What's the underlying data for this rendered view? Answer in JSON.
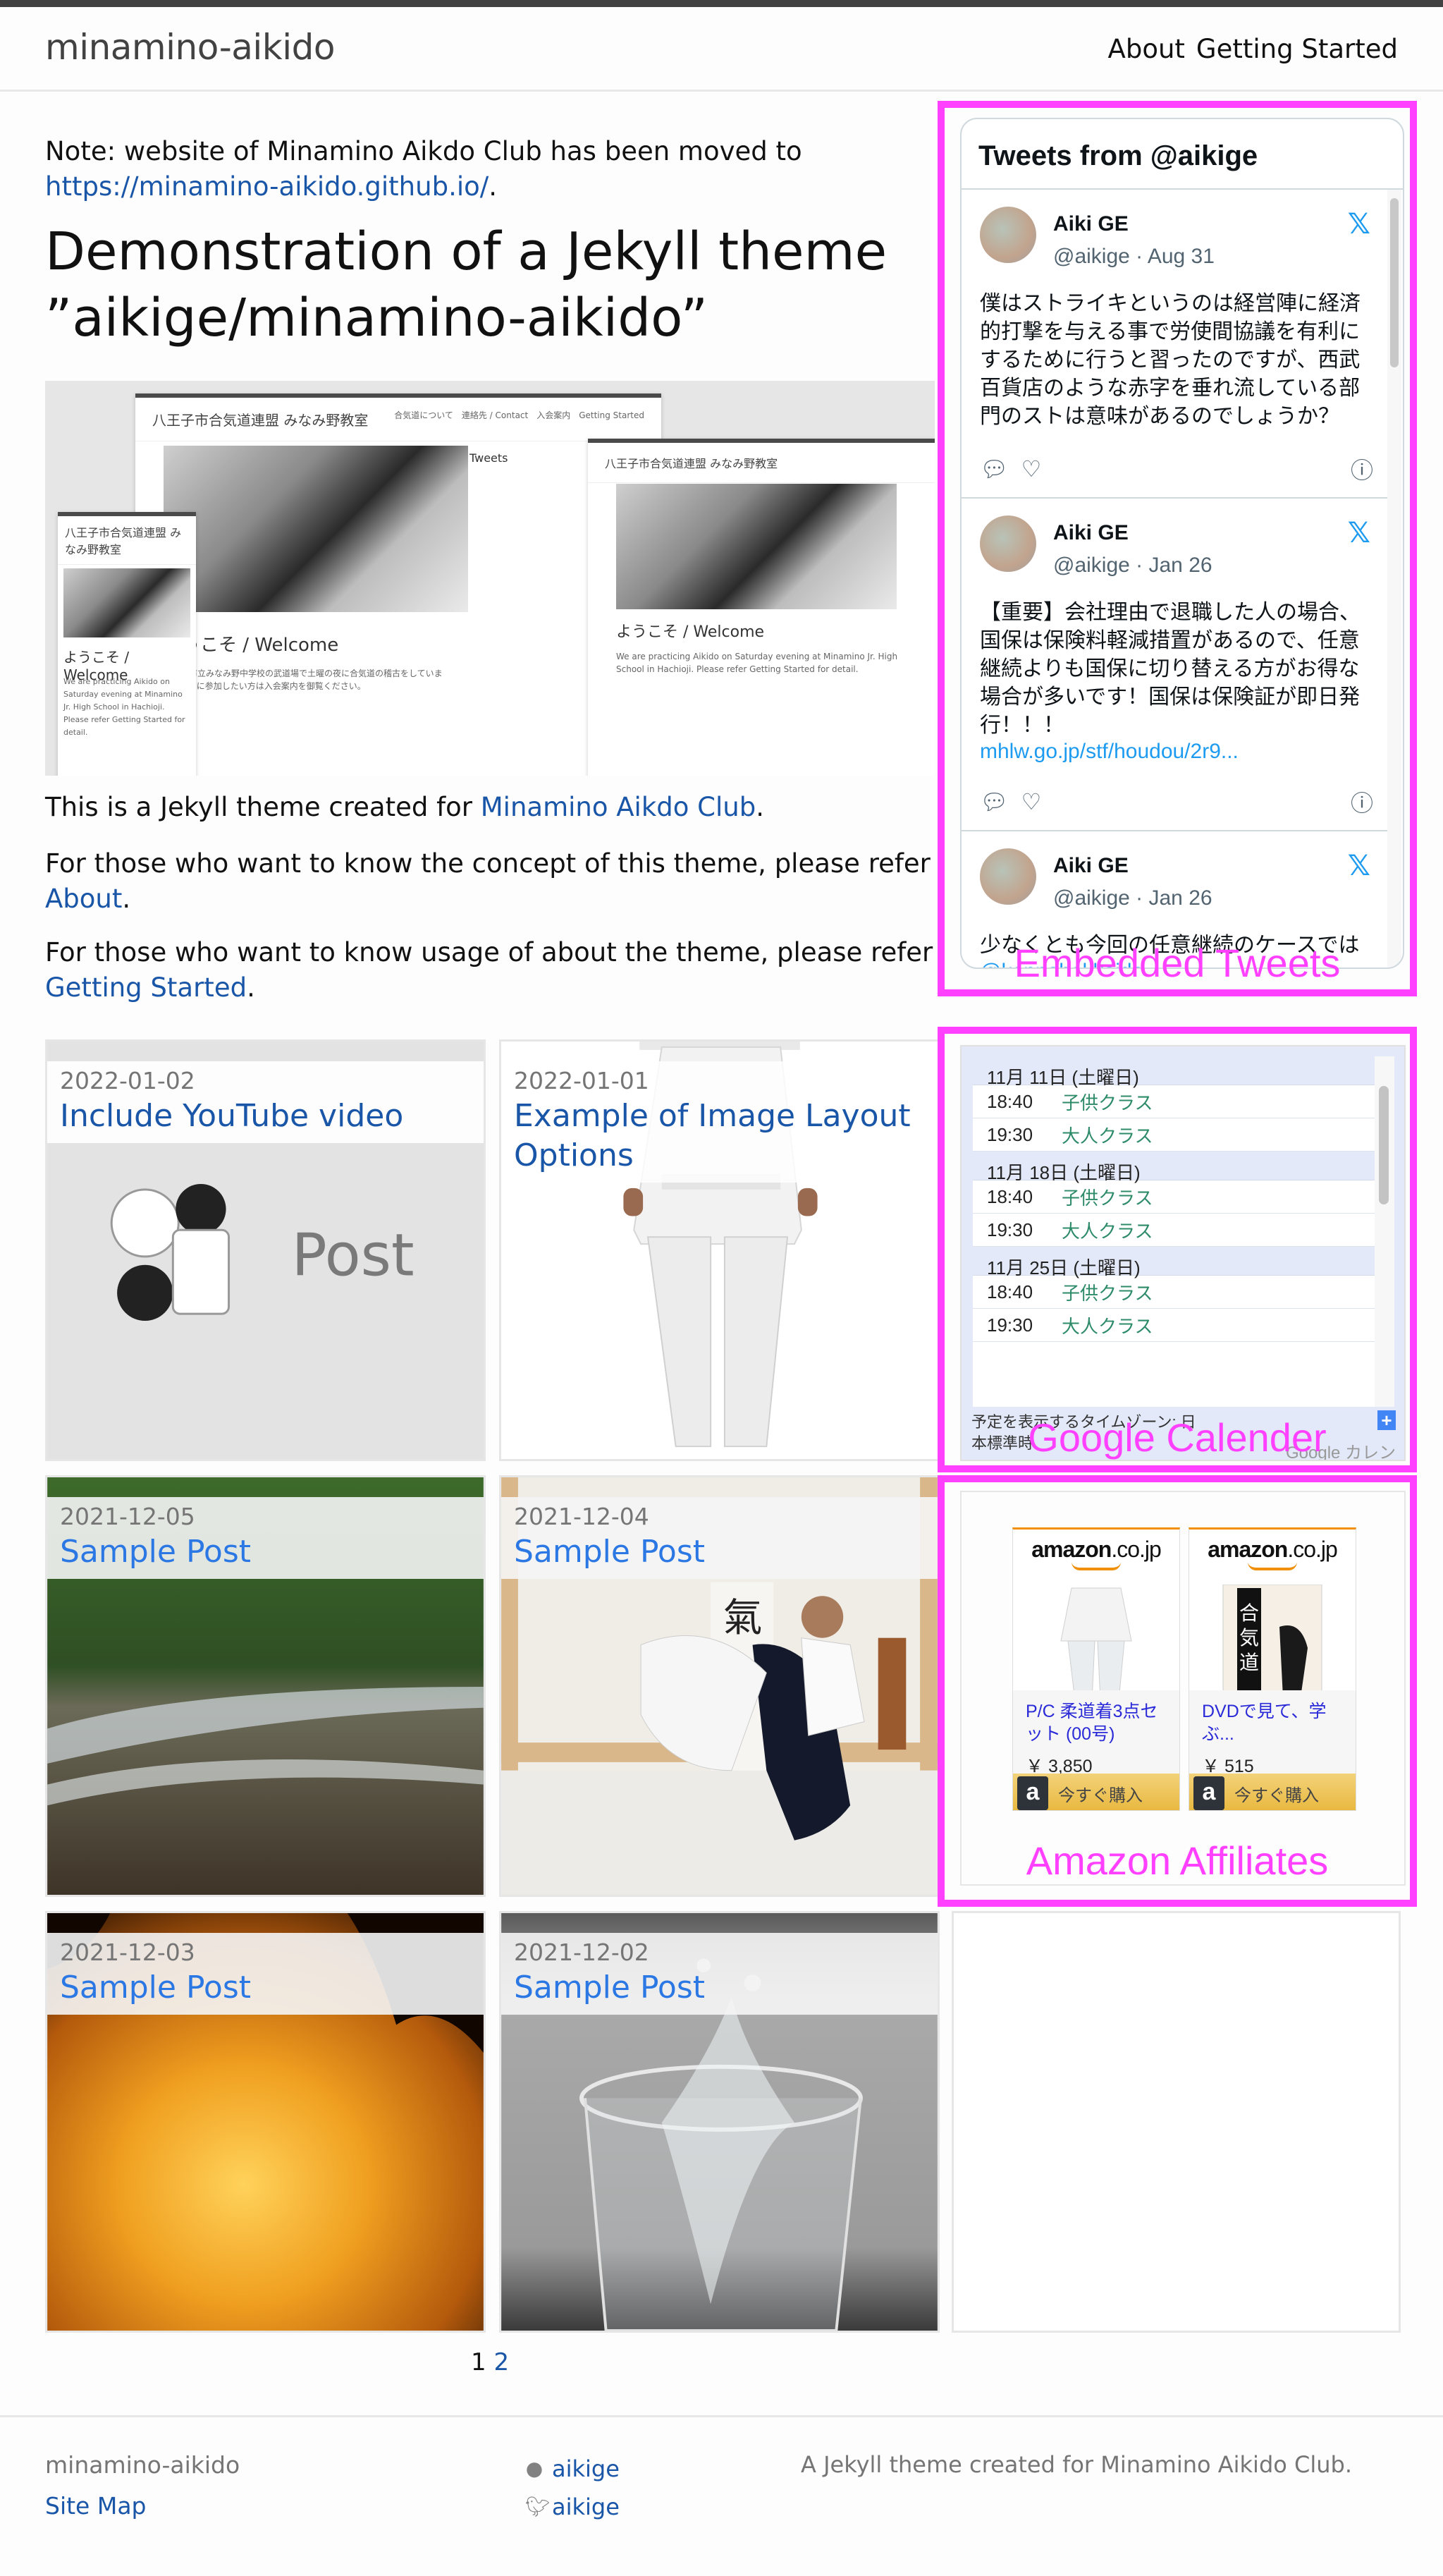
{
  "header": {
    "site_title": "minamino-aikido",
    "nav": [
      {
        "label": "About"
      },
      {
        "label": "Getting Started"
      }
    ]
  },
  "intro": {
    "note_prefix": "Note: website of Minamino Aikdo Club has been moved to",
    "note_link": "https://minamino-aikido.github.io/",
    "note_suffix": ".",
    "title_line1": "Demonstration of a Jekyll theme",
    "title_line2": "”aikige/minamino-aikido”",
    "demo_image": {
      "site_title": "八王子市合気道連盟 みなみ野教室",
      "menu": "合気道について　連絡先 / Contact　入会案内　Getting Started",
      "welcome": "ようこそ / Welcome",
      "tweets_label": "Tweets",
      "body_ja": "八王子市立みなみ野中学校の武道場で土曜の夜に合気道の稽古をしています。稽古に参加したい方は入会案内を御覧ください。",
      "body_en": "We are practicing Aikido on Saturday evening at Minamino Jr. High School in Hachioji. Please refer Getting Started for detail."
    },
    "para1_prefix": "This is a Jekyll theme created for ",
    "para1_link": "Minamino Aikdo Club",
    "para1_suffix": ".",
    "para2_prefix": "For those who want to know the concept of this theme, please refer ",
    "para2_link": "About",
    "para2_suffix": ".",
    "para3_prefix": "For those who want to know usage of about the theme, please refer ",
    "para3_link": "Getting Started",
    "para3_suffix": "."
  },
  "posts": [
    {
      "date": "2022-01-02",
      "title": "Include YouTube video",
      "image": "post-placeholder-aikido-illustration",
      "image_text": "Post"
    },
    {
      "date": "2022-01-01",
      "title": "Example of Image Layout Options",
      "image": "white-dogi-photo"
    },
    {
      "date": "2021-12-05",
      "title": "Sample Post",
      "image": "river-photo"
    },
    {
      "date": "2021-12-04",
      "title": "Sample Post",
      "image": "aikido-throw-photo"
    },
    {
      "date": "2021-12-03",
      "title": "Sample Post",
      "image": "fire-photo"
    },
    {
      "date": "2021-12-02",
      "title": "Sample Post",
      "image": "water-glass-photo"
    }
  ],
  "sidebar": {
    "tweets": {
      "label": "Embedded Tweets",
      "header": "Tweets from @aikige",
      "items": [
        {
          "name": "Aiki GE",
          "handle": "@aikige · Aug 31",
          "text": "僕はストライキというのは経営陣に経済的打撃を与える事で労使間協議を有利にするために行うと習ったのですが、西武百貨店のような赤字を垂れ流している部門のストは意味があるのでしょうか？",
          "link": ""
        },
        {
          "name": "Aiki GE",
          "handle": "@aikige · Jan 26",
          "text": "【重要】会社理由で退職した人の場合、国保は保険料軽減措置があるので、任意継続よりも国保に切り替える方がお得な場合が多いです！国保は保険証が即日発行！！！",
          "link": "mhlw.go.jp/stf/houdou/2r9..."
        },
        {
          "name": "Aiki GE",
          "handle": "@aikige · Jan 26",
          "text": "少なくとも今回の任意継続のケースでは",
          "link": "@kenpohokkaido"
        }
      ]
    },
    "calendar": {
      "label": "Google Calender",
      "days": [
        {
          "date": "11月 11日 (土曜日)",
          "events": [
            {
              "time": "18:40",
              "name": "子供クラス"
            },
            {
              "time": "19:30",
              "name": "大人クラス"
            }
          ]
        },
        {
          "date": "11月 18日 (土曜日)",
          "events": [
            {
              "time": "18:40",
              "name": "子供クラス"
            },
            {
              "time": "19:30",
              "name": "大人クラス"
            }
          ]
        },
        {
          "date": "11月 25日 (土曜日)",
          "events": [
            {
              "time": "18:40",
              "name": "子供クラス"
            },
            {
              "time": "19:30",
              "name": "大人クラス"
            }
          ]
        }
      ],
      "timezone": "予定を表示するタイムゾーン: 日本標準時",
      "brand": "Google カレンダー",
      "add_label": "+"
    },
    "amazon": {
      "label": "Amazon Affiliates",
      "logo_main": "amazon",
      "logo_suffix": ".co.jp",
      "items": [
        {
          "title": "P/C 柔道着3点セット (00号)",
          "price": "￥ 3,850",
          "buy": "今すぐ購入"
        },
        {
          "title": "DVDで見て、学ぶ...",
          "price": "￥ 515",
          "buy": "今すぐ購入"
        }
      ]
    }
  },
  "pagination": {
    "current": "1",
    "pages": [
      "2"
    ]
  },
  "footer": {
    "title": "minamino-aikido",
    "sitemap": "Site Map",
    "github": "aikige",
    "twitter": "aikige",
    "description": "A Jekyll theme created for Minamino Aikido Club."
  },
  "colors": {
    "link": "#1a56a8",
    "annotation_frame": "#ff40ff",
    "header_bar": "#424242"
  }
}
